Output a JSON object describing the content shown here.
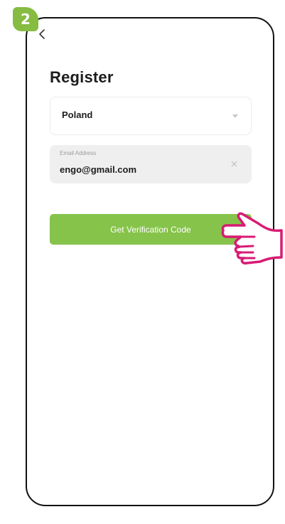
{
  "step": {
    "number": "2"
  },
  "screen": {
    "title": "Register",
    "back_icon": "chevron-left-icon"
  },
  "country": {
    "value": "Poland",
    "icon": "chevron-down-icon"
  },
  "email": {
    "label": "Email Address",
    "value": "engo@gmail.com",
    "clear_icon": "close-icon"
  },
  "verify_button": {
    "label": "Get Verification Code"
  },
  "pointer": {
    "icon": "pointing-hand-icon"
  },
  "colors": {
    "accent": "#86bc42",
    "button": "#86c34a",
    "hand_outline": "#d81b74",
    "field_background": "#efefef"
  }
}
